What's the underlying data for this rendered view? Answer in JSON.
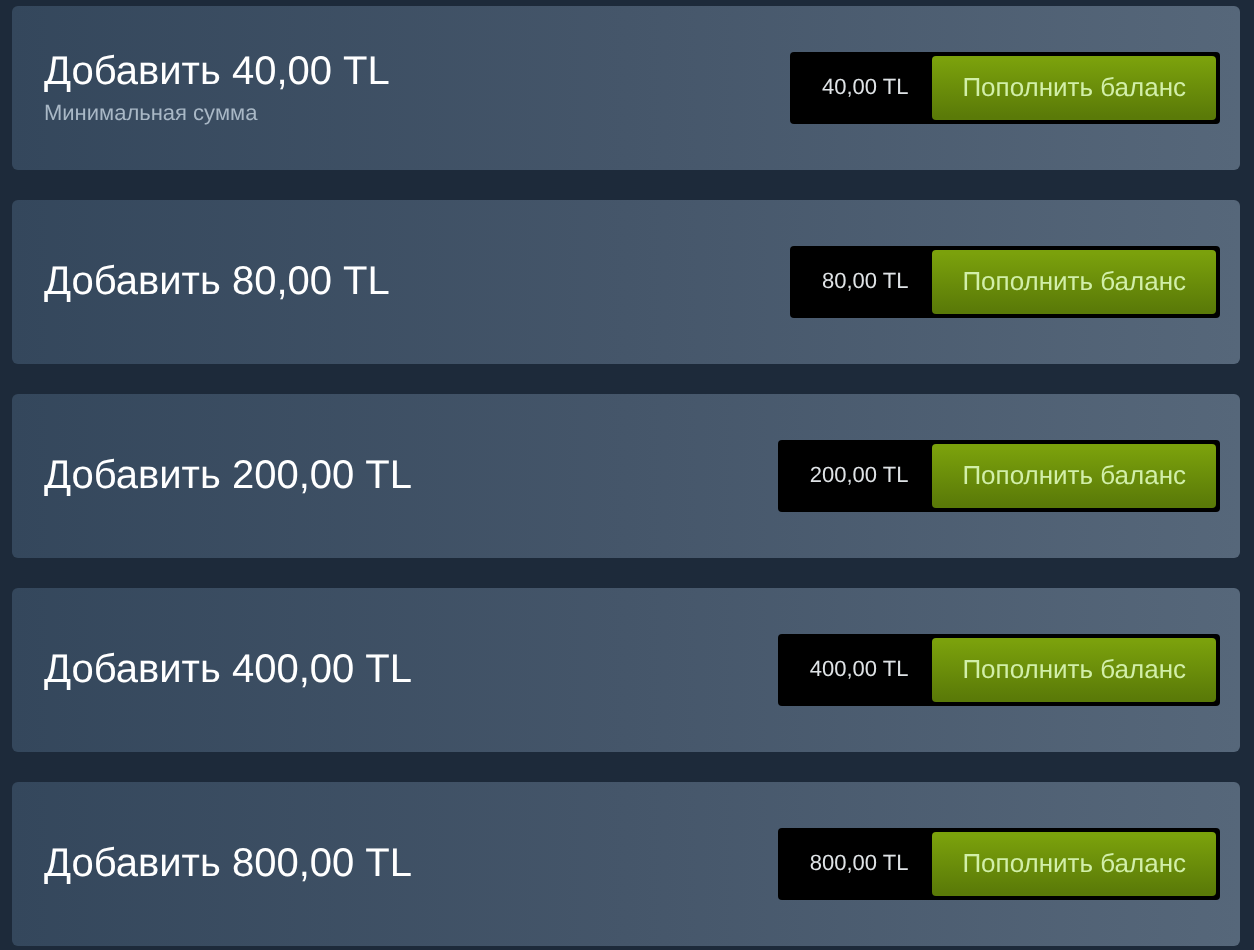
{
  "options": [
    {
      "title": "Добавить 40,00 TL",
      "note": "Минимальная сумма",
      "price": "40,00 TL",
      "button": "Пополнить баланс"
    },
    {
      "title": "Добавить 80,00 TL",
      "price": "80,00 TL",
      "button": "Пополнить баланс"
    },
    {
      "title": "Добавить 200,00 TL",
      "price": "200,00 TL",
      "button": "Пополнить баланс"
    },
    {
      "title": "Добавить 400,00 TL",
      "price": "400,00 TL",
      "button": "Пополнить баланс"
    },
    {
      "title": "Добавить 800,00 TL",
      "price": "800,00 TL",
      "button": "Пополнить баланс"
    }
  ]
}
